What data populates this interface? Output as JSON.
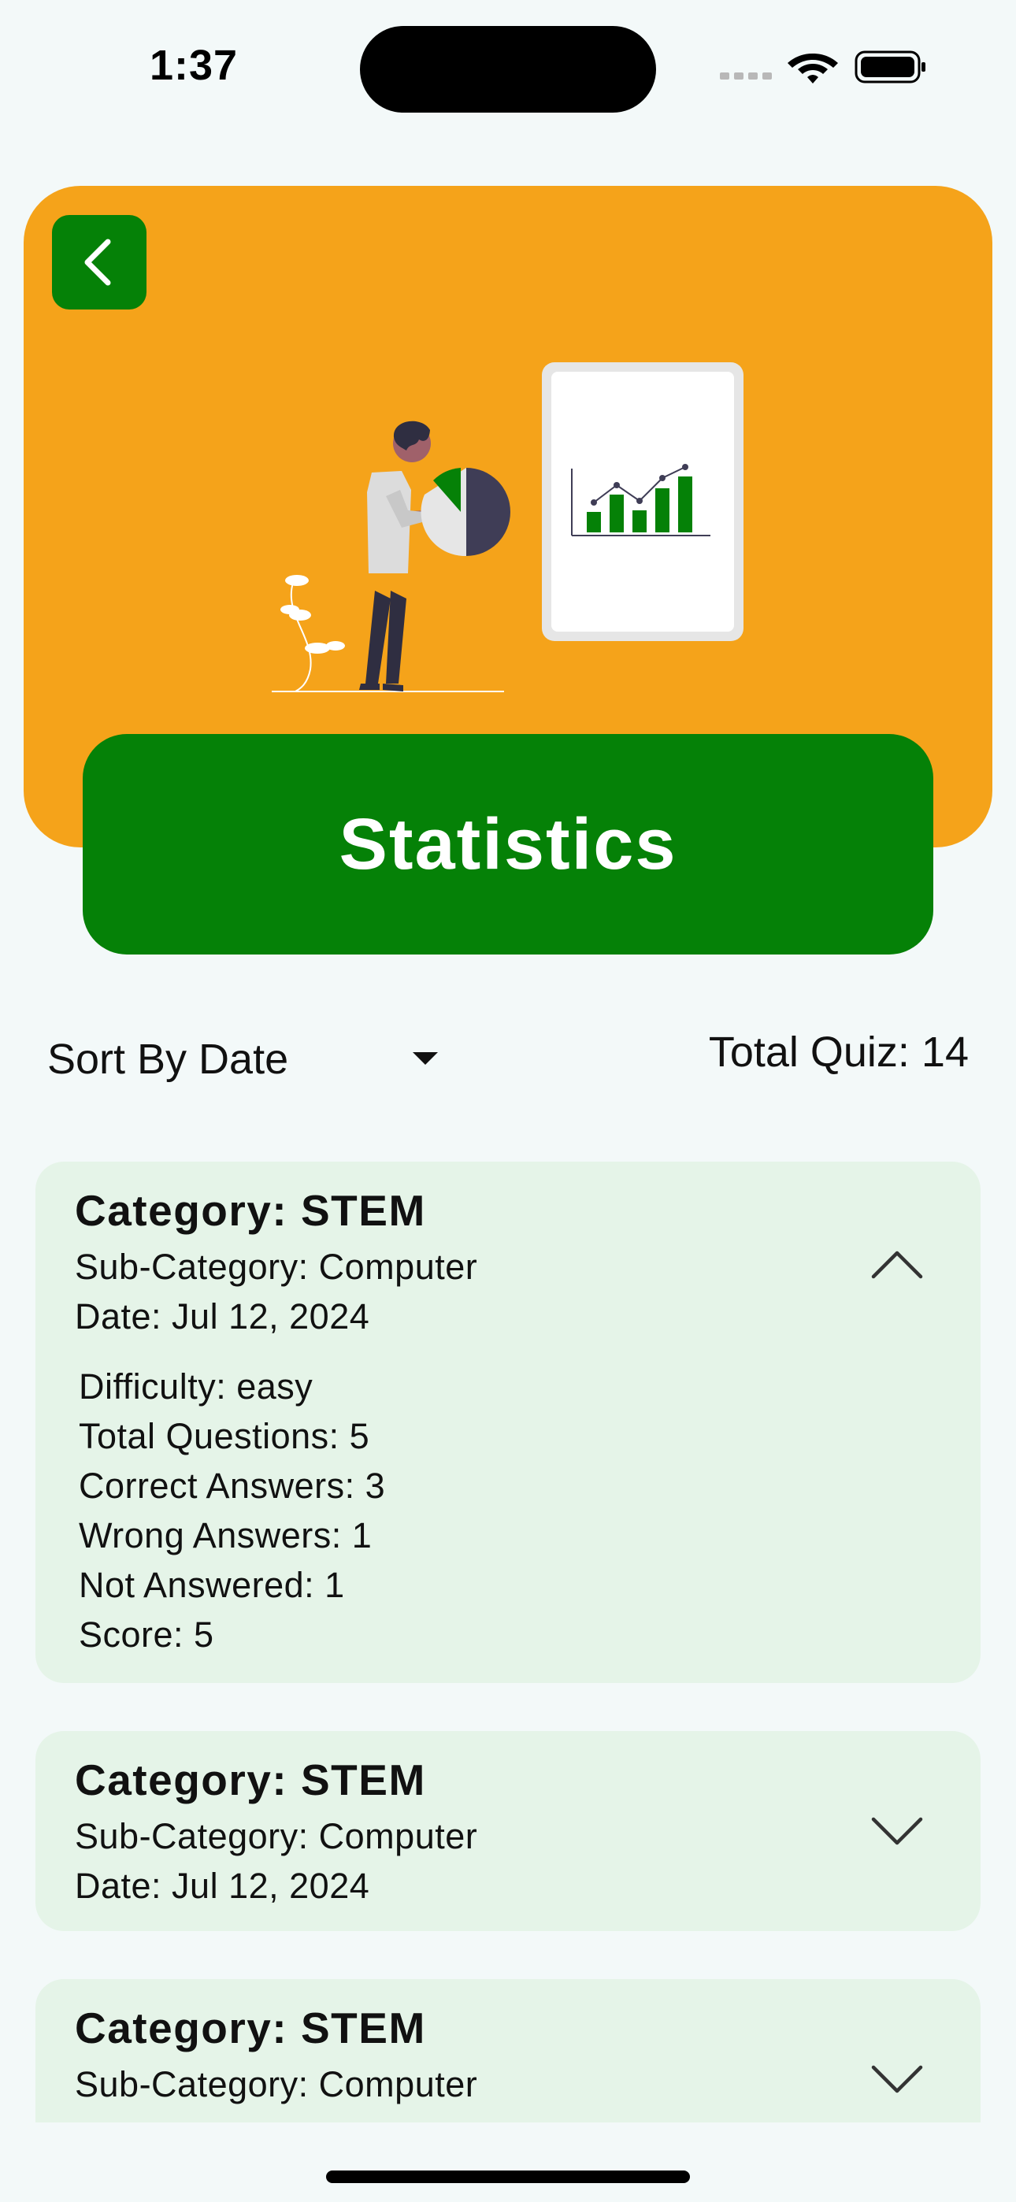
{
  "status_bar": {
    "time": "1:37"
  },
  "header": {
    "back_icon": "chevron-left-icon",
    "title": "Statistics",
    "colors": {
      "header_bg": "#f5a31a",
      "accent": "#058107"
    }
  },
  "toolbar": {
    "sort_label": "Sort By Date",
    "total_quiz_label": "Total Quiz: 14"
  },
  "quizzes": [
    {
      "category": "Category: STEM",
      "sub_category": "Sub-Category: Computer",
      "date": "Date: Jul 12, 2024",
      "expanded": true,
      "details": {
        "difficulty": "Difficulty: easy",
        "total_questions": "Total Questions: 5",
        "correct_answers": "Correct Answers: 3",
        "wrong_answers": "Wrong Answers: 1",
        "not_answered": "Not Answered: 1",
        "score": "Score: 5"
      }
    },
    {
      "category": "Category: STEM",
      "sub_category": "Sub-Category: Computer",
      "date": "Date: Jul 12, 2024",
      "expanded": false
    },
    {
      "category": "Category: STEM",
      "sub_category": "Sub-Category: Computer",
      "expanded": false
    }
  ]
}
